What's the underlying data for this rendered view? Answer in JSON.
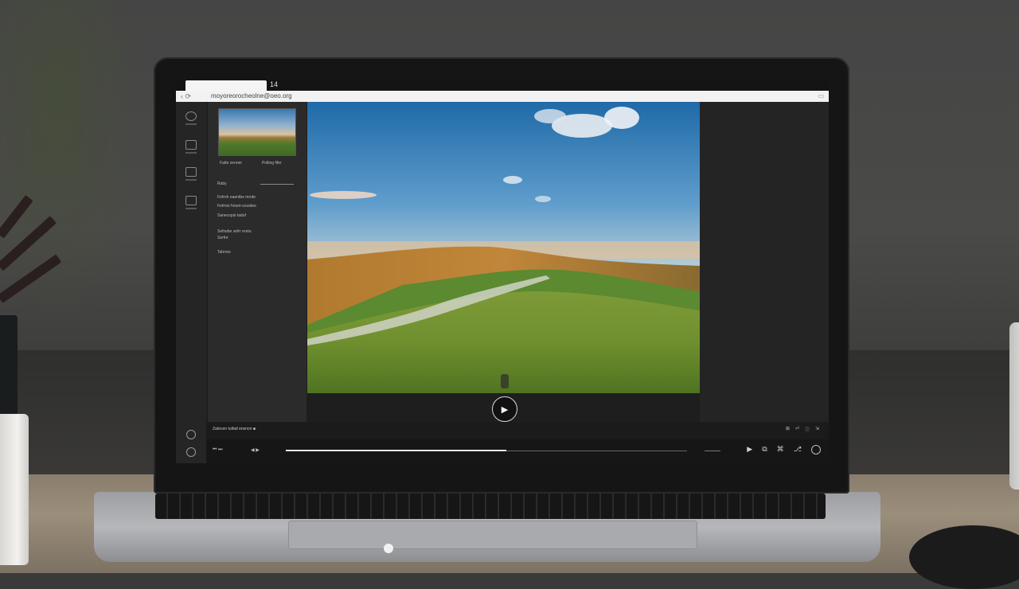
{
  "browser": {
    "tab_label": "14",
    "nav_symbol": "‹ ⟳",
    "url": "moyoreorocheolne@oeo.org",
    "extension_symbol": "▭"
  },
  "left_rail": {
    "items": [
      {
        "name": "rail-item-1"
      },
      {
        "name": "rail-item-2"
      },
      {
        "name": "rail-item-3"
      },
      {
        "name": "rail-item-4"
      }
    ]
  },
  "media_panel": {
    "thumbnail_caption_left": "Fatte zenner",
    "thumbnail_caption_right": "Polling fifer",
    "section_label": "Raby",
    "lines": [
      "Fefrnh eaentbe mrofe",
      "Fefrnoi hnoet-oouidee",
      "Sanecopsi taduf"
    ],
    "line_b": [
      "Sefrwbe sefrr eretu",
      "Serfre"
    ],
    "line_c": "Tahrres"
  },
  "viewer": {
    "play_symbol": "▶"
  },
  "status_bar": {
    "left_text": "Zatecen   tuifad ensnon ■",
    "right_items": [
      "⊞",
      "⏎",
      "ⓘ",
      "⇲"
    ]
  },
  "timeline": {
    "left_label": "⏮  ⏭",
    "left_label_b": "◀  ▶",
    "progress_percent": 55,
    "icons": [
      "▶",
      "⧉",
      "⌘",
      "⎇"
    ]
  },
  "colors": {
    "screen_bg": "#1e1e1e",
    "panel_bg": "#2b2b2b",
    "accent": "#e8e8e8"
  }
}
